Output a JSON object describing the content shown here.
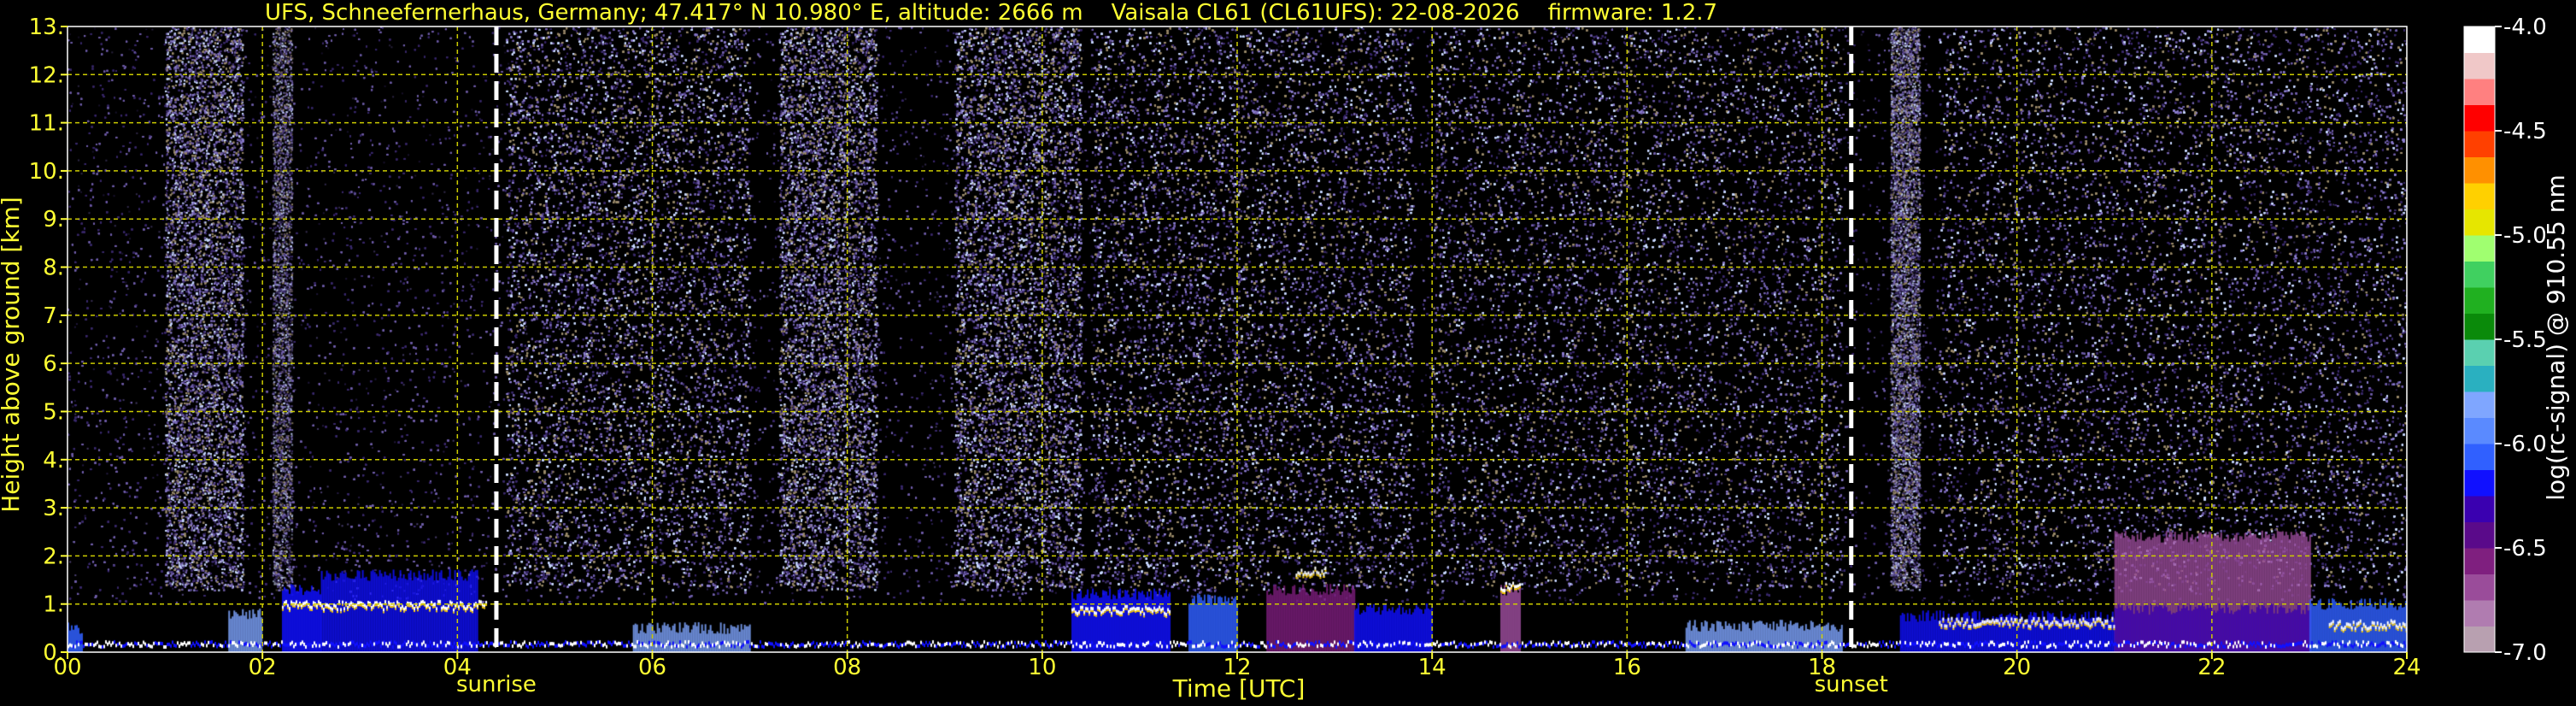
{
  "chart_data": {
    "type": "heatmap",
    "title": "UFS, Schneefernerhaus, Germany; 47.417° N 10.980° E, altitude: 2666 m    Vaisala CL61 (CL61UFS): 22-08-2026    firmware: 1.2.7",
    "xlabel": "Time [UTC]",
    "ylabel": "Height above ground [km]",
    "xlim": [
      0,
      24
    ],
    "ylim": [
      0,
      13
    ],
    "x_ticks": [
      "00",
      "02",
      "04",
      "06",
      "08",
      "10",
      "12",
      "14",
      "16",
      "18",
      "20",
      "22",
      "24"
    ],
    "y_ticks": [
      "0.",
      "1.",
      "2.",
      "3.",
      "4.",
      "5.",
      "6.",
      "7.",
      "8.",
      "9.",
      "10.",
      "11.",
      "12.",
      "13."
    ],
    "grid": true,
    "annotations": [
      {
        "x": 4.4,
        "label": "sunrise"
      },
      {
        "x": 18.3,
        "label": "sunset"
      }
    ],
    "colorbar": {
      "label": "log(rc-signal) @ 910.55 nm",
      "range": [
        -7.0,
        -4.0
      ],
      "ticks": [
        "-4.0",
        "-4.5",
        "-5.0",
        "-5.5",
        "-6.0",
        "-6.5",
        "-7.0"
      ],
      "colors": [
        "#b8a0b0",
        "#b07cb0",
        "#9a4c9a",
        "#7f1f7f",
        "#5a0a8a",
        "#3a00b0",
        "#1010ff",
        "#3060ff",
        "#5a8aff",
        "#7fa6ff",
        "#2ab0c0",
        "#5ad0b0",
        "#0a8a0a",
        "#20b020",
        "#40d060",
        "#a0ff70",
        "#e6e600",
        "#ffd000",
        "#ff9000",
        "#ff4000",
        "#ff0000",
        "#ff8080",
        "#f0c8c8",
        "#ffffff"
      ]
    },
    "background_colors": {
      "noise": [
        "#3a2a6a",
        "#6f5ea8",
        "#8a7ccc",
        "#c8d8ff",
        "#9a8a6a"
      ]
    },
    "noise_bands": [
      {
        "x0": 1.0,
        "x1": 1.8,
        "strength": 0.8
      },
      {
        "x0": 2.1,
        "x1": 2.3,
        "strength": 0.5
      },
      {
        "x0": 4.5,
        "x1": 7.0,
        "strength": 0.6
      },
      {
        "x0": 7.3,
        "x1": 8.3,
        "strength": 0.9
      },
      {
        "x0": 9.1,
        "x1": 10.4,
        "strength": 1.0
      },
      {
        "x0": 10.5,
        "x1": 13.8,
        "strength": 0.55
      },
      {
        "x0": 14.0,
        "x1": 18.2,
        "strength": 0.4
      },
      {
        "x0": 18.7,
        "x1": 19.0,
        "strength": 0.8
      },
      {
        "x0": 19.2,
        "x1": 24.0,
        "strength": 0.45
      }
    ],
    "boundary_layer": [
      {
        "x0": 0.0,
        "x1": 0.15,
        "top": 0.5,
        "color": "#3060ff"
      },
      {
        "x0": 1.65,
        "x1": 2.0,
        "top": 0.8,
        "color": "#7fa6ff"
      },
      {
        "x0": 2.2,
        "x1": 2.6,
        "top": 1.3,
        "color": "#1010ff"
      },
      {
        "x0": 2.6,
        "x1": 4.2,
        "top": 1.6,
        "color": "#1010ff"
      },
      {
        "x0": 5.8,
        "x1": 7.0,
        "top": 0.5,
        "color": "#7fa6ff"
      },
      {
        "x0": 10.3,
        "x1": 11.3,
        "top": 1.2,
        "color": "#1010ff"
      },
      {
        "x0": 11.5,
        "x1": 12.0,
        "top": 1.1,
        "color": "#3060ff"
      },
      {
        "x0": 12.3,
        "x1": 13.2,
        "top": 1.3,
        "color": "#7f1f7f"
      },
      {
        "x0": 13.2,
        "x1": 14.0,
        "top": 0.9,
        "color": "#1010ff"
      },
      {
        "x0": 14.7,
        "x1": 14.9,
        "top": 1.3,
        "color": "#9a4c9a"
      },
      {
        "x0": 16.6,
        "x1": 18.2,
        "top": 0.55,
        "color": "#7fa6ff"
      },
      {
        "x0": 18.8,
        "x1": 21.0,
        "top": 0.75,
        "color": "#1010ff"
      },
      {
        "x0": 21.0,
        "x1": 23.0,
        "top": 2.4,
        "color": "#9a4c9a"
      },
      {
        "x0": 21.0,
        "x1": 23.0,
        "top": 0.9,
        "color": "#3a00b0"
      },
      {
        "x0": 23.0,
        "x1": 24.0,
        "top": 1.0,
        "color": "#3060ff"
      }
    ],
    "cloud_layers": [
      {
        "x0": 2.2,
        "x1": 4.3,
        "y": 1.0
      },
      {
        "x0": 10.3,
        "x1": 11.3,
        "y": 0.9
      },
      {
        "x0": 12.6,
        "x1": 12.9,
        "y": 1.7
      },
      {
        "x0": 14.7,
        "x1": 14.9,
        "y": 1.4
      },
      {
        "x0": 19.2,
        "x1": 21.0,
        "y": 0.65
      },
      {
        "x0": 23.2,
        "x1": 24.0,
        "y": 0.6
      }
    ]
  }
}
